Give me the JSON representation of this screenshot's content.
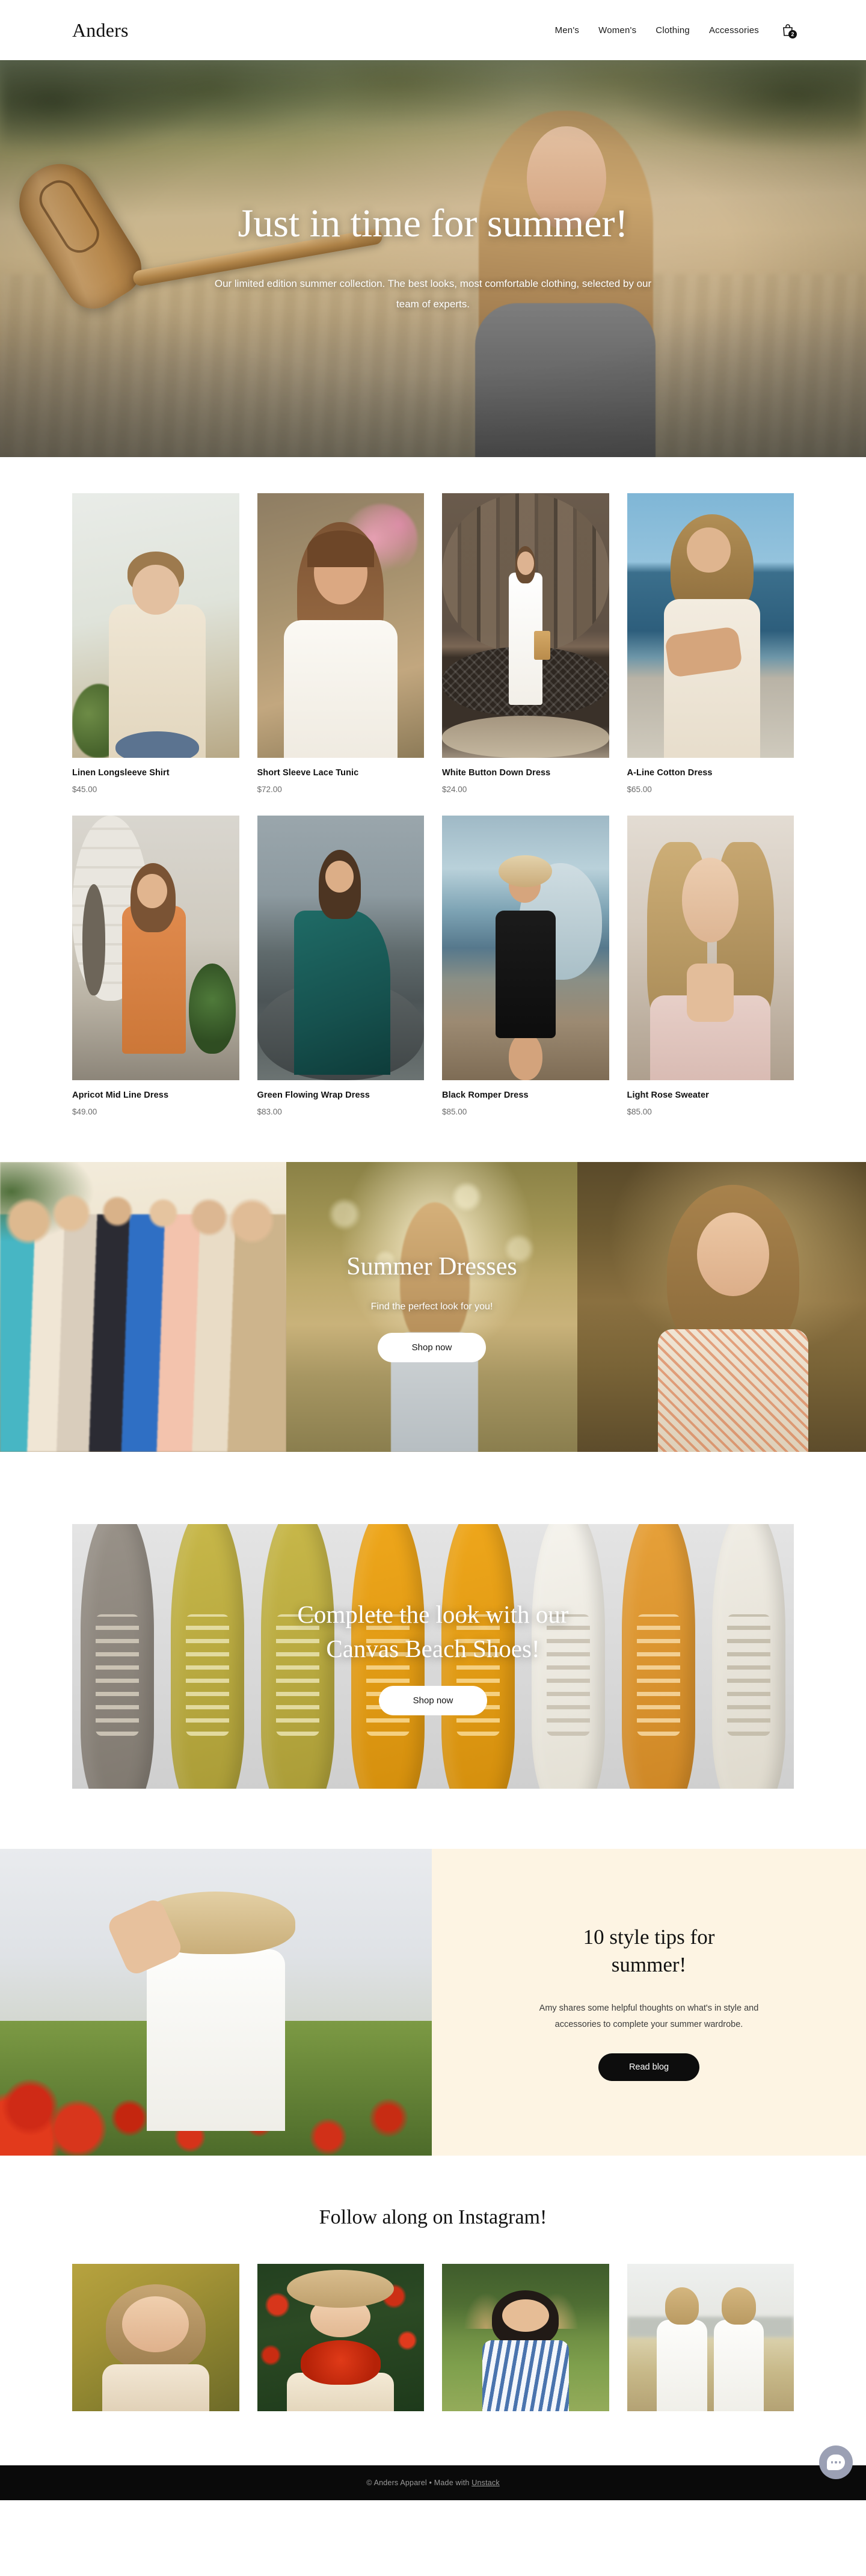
{
  "header": {
    "brand": "Anders",
    "nav": [
      {
        "label": "Men's"
      },
      {
        "label": "Women's"
      },
      {
        "label": "Clothing"
      },
      {
        "label": "Accessories"
      }
    ],
    "cart": {
      "icon": "shopping-bag-icon",
      "count": "2"
    }
  },
  "hero": {
    "title": "Just in time for summer!",
    "subtitle": "Our limited edition summer collection. The best looks, most comfortable clothing, selected by our team of experts."
  },
  "products": {
    "row1": [
      {
        "name": "Linen Longsleeve Shirt",
        "price": "$45.00"
      },
      {
        "name": "Short Sleeve Lace Tunic",
        "price": "$72.00"
      },
      {
        "name": "White Button Down Dress",
        "price": "$24.00"
      },
      {
        "name": "A-Line Cotton Dress",
        "price": "$65.00"
      }
    ],
    "row2": [
      {
        "name": "Apricot Mid Line Dress",
        "price": "$49.00"
      },
      {
        "name": "Green Flowing Wrap Dress",
        "price": "$83.00"
      },
      {
        "name": "Black Romper Dress",
        "price": "$85.00"
      },
      {
        "name": "Light Rose Sweater",
        "price": "$85.00"
      }
    ]
  },
  "dress_banner": {
    "title": "Summer Dresses",
    "subtitle": "Find the perfect look for you!",
    "cta": "Shop now"
  },
  "shoes_banner": {
    "title_line1": "Complete the look with our",
    "title_line2": "Canvas Beach Shoes!",
    "cta": "Shop now"
  },
  "blog": {
    "title_line1": "10 style tips for",
    "title_line2": "summer!",
    "body": "Amy shares some helpful thoughts on what's in style and accessories to complete your summer wardrobe.",
    "cta": "Read blog"
  },
  "instagram": {
    "title": "Follow along on Instagram!"
  },
  "footer": {
    "text": "© Anders Apparel • Made with ",
    "link": "Unstack"
  },
  "chat": {
    "icon": "chat-bubble-icon"
  },
  "colors": {
    "accent_cream": "#FDF4E3",
    "dark": "#0a0a0a",
    "chat": "#9ba0b4"
  }
}
